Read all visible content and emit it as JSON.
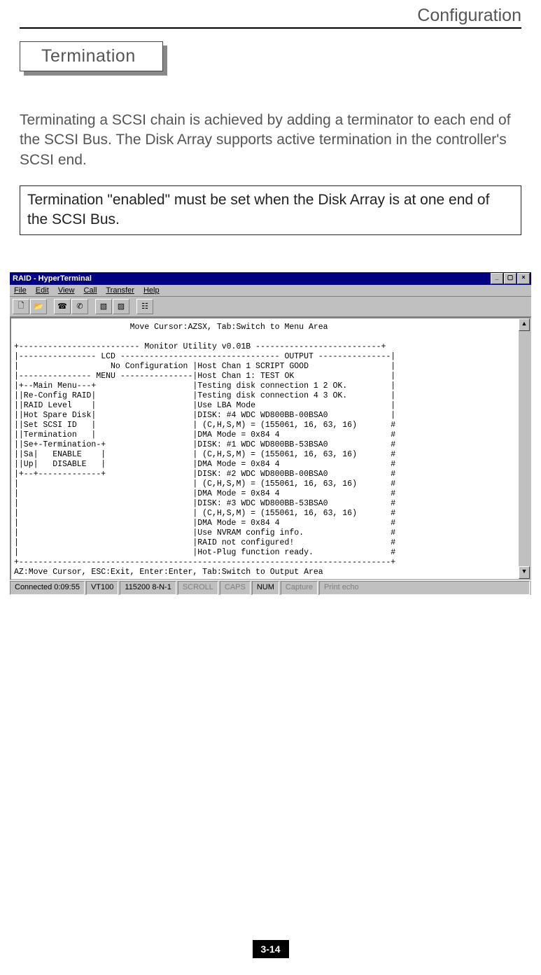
{
  "page": {
    "header": "Configuration",
    "section_title": "Termination",
    "body_paragraph": "Terminating a SCSI chain is achieved by adding a terminator to each end of the SCSI Bus. The Disk Array  supports active termination in the controller's SCSI end.",
    "note": "Termination \"enabled\" must be set when the Disk Array is at one end of the SCSI Bus.",
    "page_number": "3-14"
  },
  "terminal": {
    "title": "RAID - HyperTerminal",
    "menu": [
      "File",
      "Edit",
      "View",
      "Call",
      "Transfer",
      "Help"
    ],
    "statusbar": {
      "connect": "Connected 0:09:55",
      "emulation": "VT100",
      "settings": "115200 8-N-1",
      "scroll": "SCROLL",
      "caps": "CAPS",
      "num": "NUM",
      "capture": "Capture",
      "print": "Print echo"
    },
    "content": "                        Move Cursor:AZSX, Tab:Switch to Menu Area\n\n+------------------------- Monitor Utility v0.01B --------------------------+\n|---------------- LCD --------------------------------- OUTPUT ---------------|\n|                   No Configuration |Host Chan 1 SCRIPT GOOD                 |\n|--------------- MENU ---------------|Host Chan 1: TEST OK                    |\n|+--Main Menu---+                    |Testing disk connection 1 2 OK.         |\n||Re-Config RAID|                    |Testing disk connection 4 3 OK.         |\n||RAID Level    |                    |Use LBA Mode                            |\n||Hot Spare Disk|                    |DISK: #4 WDC WD800BB-00BSA0             |\n||Set SCSI ID   |                    | (C,H,S,M) = (155061, 16, 63, 16)       #\n||Termination   |                    |DMA Mode = 0x84 4                       #\n||Se+-Termination-+                  |DISK: #1 WDC WD800BB-53BSA0             #\n||Sa|   ENABLE    |                  | (C,H,S,M) = (155061, 16, 63, 16)       #\n||Up|   DISABLE   |                  |DMA Mode = 0x84 4                       #\n|+--+-------------+                  |DISK: #2 WDC WD800BB-00BSA0             #\n|                                    | (C,H,S,M) = (155061, 16, 63, 16)       #\n|                                    |DMA Mode = 0x84 4                       #\n|                                    |DISK: #3 WDC WD800BB-53BSA0             #\n|                                    | (C,H,S,M) = (155061, 16, 63, 16)       #\n|                                    |DMA Mode = 0x84 4                       #\n|                                    |Use NVRAM config info.                  #\n|                                    |RAID not configured!                    #\n|                                    |Hot-Plug function ready.                #\n+-----------------------------------------------------------------------------+\nAZ:Move Cursor, ESC:Exit, Enter:Enter, Tab:Switch to Output Area"
  }
}
